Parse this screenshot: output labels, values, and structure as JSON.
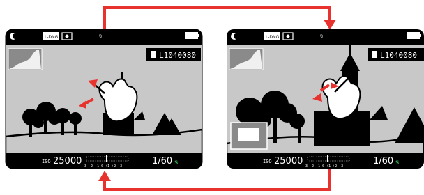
{
  "arrow_color": "#e8322d",
  "lcd_background": "#c8c8c8",
  "bar_color": "#000000",
  "screens": [
    {
      "top_bar": {
        "format_label": "L-DNG",
        "icons": [
          "photo-mode-icon",
          "dng-icon",
          "metering-spot-icon",
          "stabilization-icon",
          "battery-icon"
        ]
      },
      "file_label": "L1040080",
      "bottom_bar": {
        "iso_prefix": "ISO",
        "iso_value": "25000",
        "ev_scale": "-3 -2 -1  0 +1 +2 +3",
        "shutter": "1/60",
        "shutter_suffix": "s"
      },
      "gesture": "pinch-out"
    },
    {
      "top_bar": {
        "format_label": "L-DNG",
        "icons": [
          "photo-mode-icon",
          "dng-icon",
          "metering-spot-icon",
          "stabilization-icon",
          "battery-icon"
        ]
      },
      "file_label": "L1040080",
      "bottom_bar": {
        "iso_prefix": "ISO",
        "iso_value": "25000",
        "ev_scale": "-3 -2 -1  0 +1 +2 +3",
        "shutter": "1/60",
        "shutter_suffix": "s"
      },
      "gesture": "pinch-in"
    }
  ]
}
